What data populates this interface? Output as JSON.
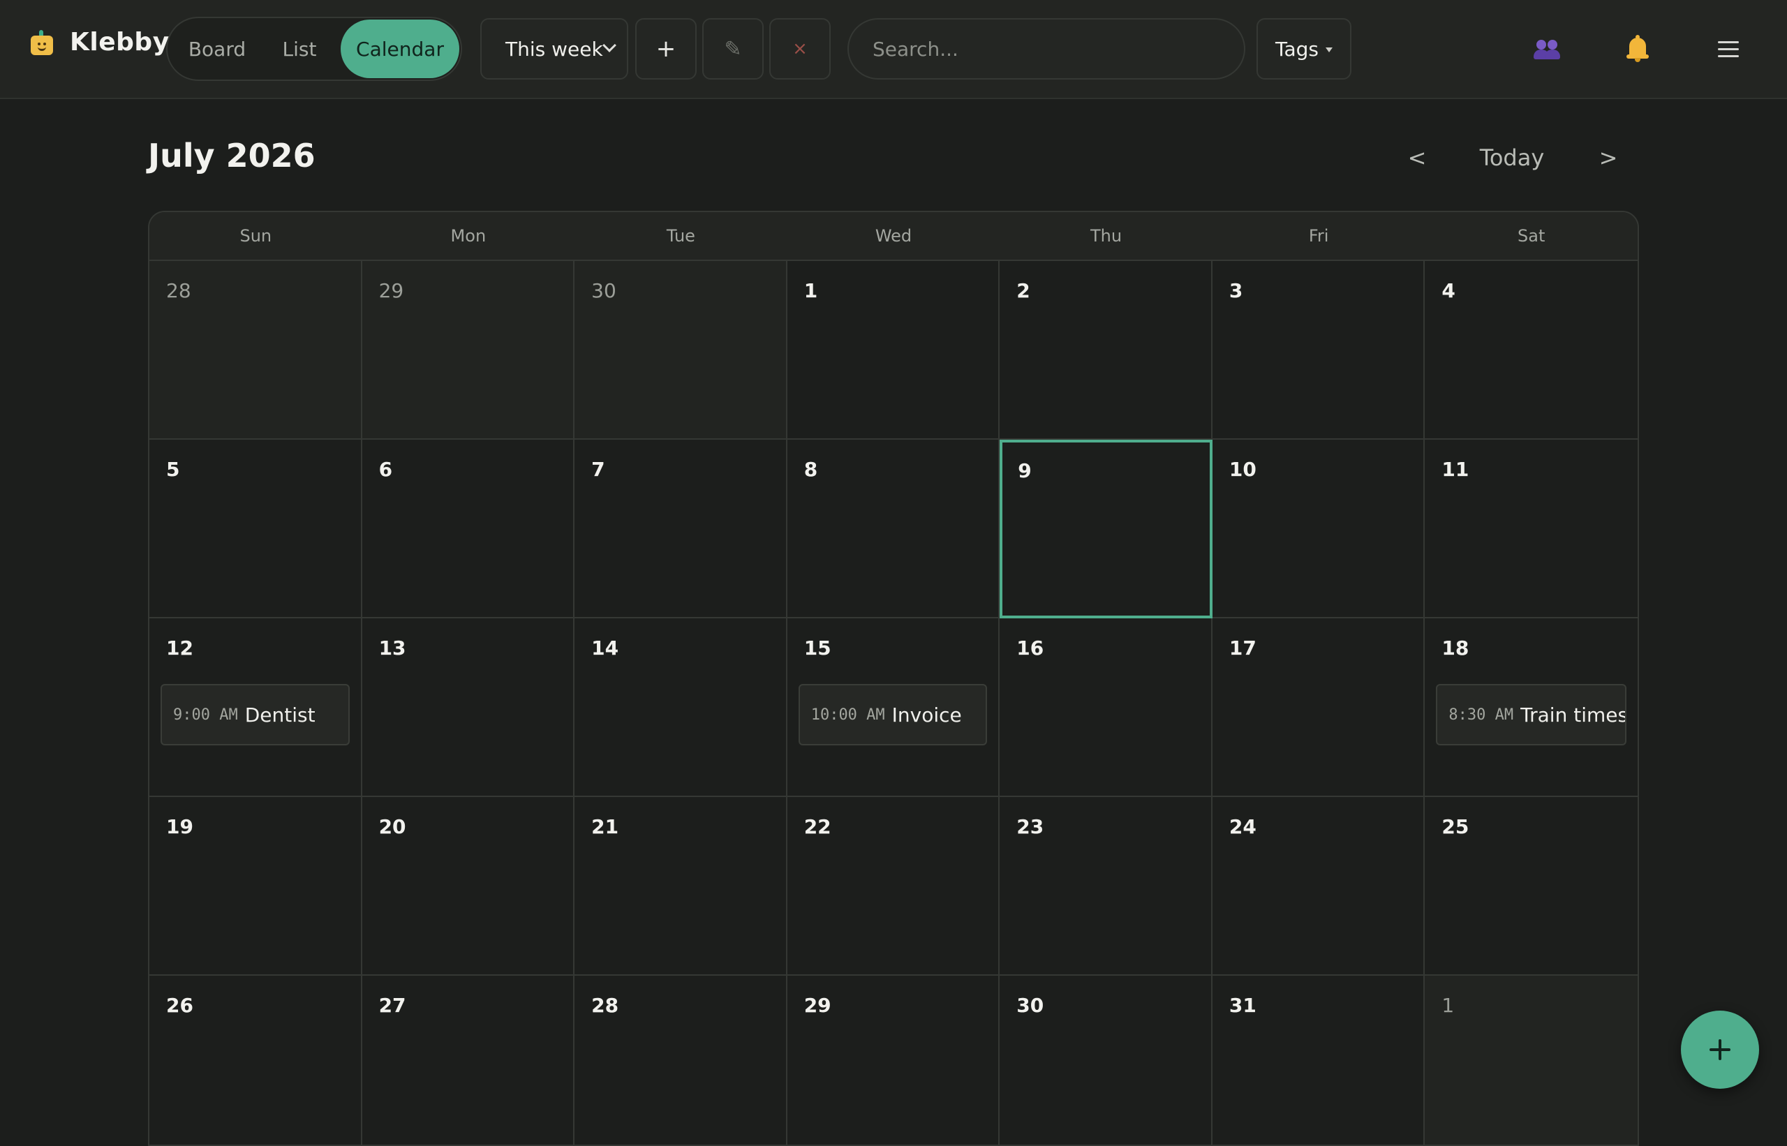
{
  "app": {
    "name": "Klebby",
    "accent": "#4fae8d"
  },
  "views": {
    "board": "Board",
    "list": "List",
    "calendar": "Calendar",
    "active": "Calendar"
  },
  "toolbar": {
    "range_select": "This week",
    "add_label": "+",
    "edit_label": "✎",
    "delete_label": "×",
    "search_placeholder": "Search...",
    "search_value": "",
    "tags_label": "Tags"
  },
  "header_icons": [
    "users-icon",
    "bell-icon",
    "menu-icon"
  ],
  "calendar": {
    "month_title": "July 2026",
    "prev_label": "<",
    "today_label": "Today",
    "next_label": ">",
    "weekdays": [
      "Sun",
      "Mon",
      "Tue",
      "Wed",
      "Thu",
      "Fri",
      "Sat"
    ],
    "today": 9,
    "days": [
      {
        "num": "28",
        "outside": true
      },
      {
        "num": "29",
        "outside": true
      },
      {
        "num": "30",
        "outside": true
      },
      {
        "num": "1"
      },
      {
        "num": "2"
      },
      {
        "num": "3"
      },
      {
        "num": "4"
      },
      {
        "num": "5"
      },
      {
        "num": "6"
      },
      {
        "num": "7"
      },
      {
        "num": "8"
      },
      {
        "num": "9",
        "today": true
      },
      {
        "num": "10"
      },
      {
        "num": "11"
      },
      {
        "num": "12",
        "event": {
          "time": "9:00 AM",
          "title": "Dentist"
        }
      },
      {
        "num": "13"
      },
      {
        "num": "14"
      },
      {
        "num": "15",
        "event": {
          "time": "10:00 AM",
          "title": "Invoice"
        }
      },
      {
        "num": "16"
      },
      {
        "num": "17"
      },
      {
        "num": "18",
        "event": {
          "time": "8:30 AM",
          "title": "Train times"
        }
      },
      {
        "num": "19"
      },
      {
        "num": "20"
      },
      {
        "num": "21"
      },
      {
        "num": "22"
      },
      {
        "num": "23"
      },
      {
        "num": "24"
      },
      {
        "num": "25"
      },
      {
        "num": "26"
      },
      {
        "num": "27"
      },
      {
        "num": "28"
      },
      {
        "num": "29"
      },
      {
        "num": "30"
      },
      {
        "num": "31"
      },
      {
        "num": "1",
        "outside": true
      }
    ]
  },
  "fab_label": "+"
}
